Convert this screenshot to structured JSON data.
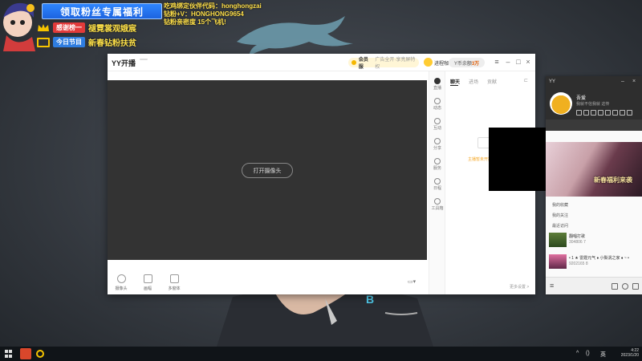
{
  "overlay": {
    "promo_banner": "领取粉丝专属福利",
    "thanks_pill": "感谢榜一",
    "thanks_text": "褪霓裳观娥宸",
    "program_pill": "今日节目",
    "program_text": "新春钻粉扶贫",
    "info_lines": [
      "吃鸡绑定伙伴代码：honghongzai",
      "钻粉+V：HONGHONG9654",
      "钻粉亲密度 15个飞机!"
    ]
  },
  "yy_window": {
    "app_title": "YY开播",
    "subtag": "",
    "vip_label": "会员服",
    "vip_sub": "广告全开·享亮屏特权",
    "user_name": "进程咖",
    "balance_prefix": "Y币余额",
    "balance_value": "3万",
    "open_camera": "打开摄像头",
    "tools": [
      {
        "label": "摄像头"
      },
      {
        "label": "画幅"
      },
      {
        "label": "多窗体"
      }
    ],
    "rail": [
      {
        "label": "直播"
      },
      {
        "label": "动态"
      },
      {
        "label": "互动"
      },
      {
        "label": "分享"
      },
      {
        "label": "服务"
      },
      {
        "label": "日程"
      },
      {
        "label": "工具箱"
      }
    ],
    "panel_tabs": [
      "聊天",
      "进场",
      "贡献"
    ],
    "empty_text": "主播暂未开播哦",
    "more_link": "更多设置 >"
  },
  "dock": {
    "title": "YY",
    "nick": "吾爱",
    "signature": "我就不信我就 这传",
    "sections": [
      "我的收藏",
      "我的关注",
      "最近访问"
    ],
    "banner_text": "新春福利来袭",
    "entries": [
      {
        "title": "翻唱打歌",
        "meta": "304806   7"
      },
      {
        "title": "• 1 ★ 雷霆元气 ♦ 小梨涡之家 ♦ ~ •",
        "meta": "9202165   8"
      }
    ]
  },
  "taskbar": {
    "time": "4:22",
    "date": "2023/1/20",
    "ime": "英",
    "volume_label": "()"
  },
  "colors": {
    "accent_blue": "#2f86ff",
    "overlay_yellow": "#ffe24a",
    "stage_gray": "#333333"
  }
}
